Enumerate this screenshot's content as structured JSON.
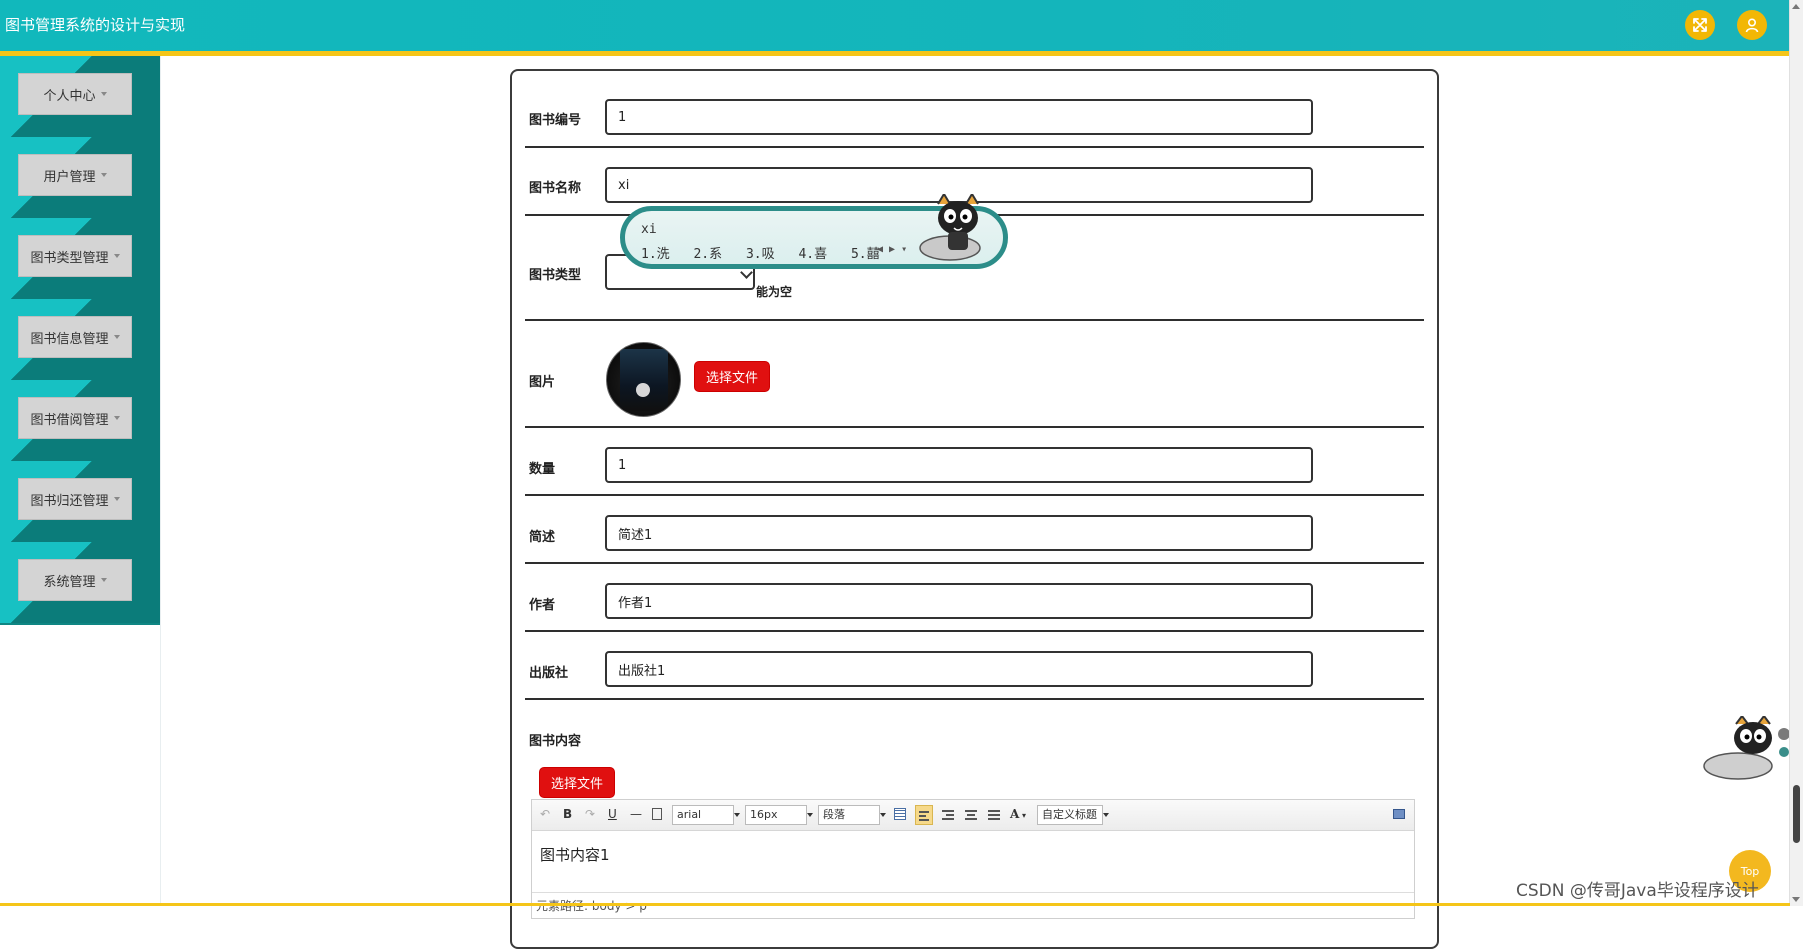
{
  "header": {
    "title": "图书管理系统的设计与实现",
    "fullscreen_icon": "expand-arrows-icon",
    "user_icon": "user-icon"
  },
  "sidebar": {
    "items": [
      {
        "label": "个人中心"
      },
      {
        "label": "用户管理"
      },
      {
        "label": "图书类型管理"
      },
      {
        "label": "图书信息管理"
      },
      {
        "label": "图书借阅管理"
      },
      {
        "label": "图书归还管理"
      },
      {
        "label": "系统管理"
      }
    ]
  },
  "form": {
    "book_number": {
      "label": "图书编号",
      "value": "1"
    },
    "book_name": {
      "label": "图书名称",
      "value": "xi"
    },
    "book_type": {
      "label": "图书类型",
      "value": "",
      "hint": "能为空"
    },
    "image": {
      "label": "图片",
      "button": "选择文件"
    },
    "quantity": {
      "label": "数量",
      "value": "1"
    },
    "summary": {
      "label": "简述",
      "value": "简述1"
    },
    "author": {
      "label": "作者",
      "value": "作者1"
    },
    "publisher": {
      "label": "出版社",
      "value": "出版社1"
    },
    "content": {
      "label": "图书内容",
      "button": "选择文件"
    }
  },
  "editor": {
    "font_family": "arial",
    "font_size": "16px",
    "paragraph": "段落",
    "custom_heading": "自定义标题",
    "body_text": "图书内容1",
    "footer": "元素路径: body > p"
  },
  "ime": {
    "input": "xi",
    "candidates": [
      "1.洗",
      "2.系",
      "3.吸",
      "4.喜",
      "5.囍"
    ]
  },
  "top_button": "Top",
  "watermark": "CSDN @传哥Java毕设程序设计",
  "colors": {
    "header_bg": "#11b8bc",
    "accent_yellow": "#f5c518",
    "sidebar_dark": "#0b7c7a",
    "sidebar_light": "#17c1c3",
    "button_red": "#e01010"
  }
}
